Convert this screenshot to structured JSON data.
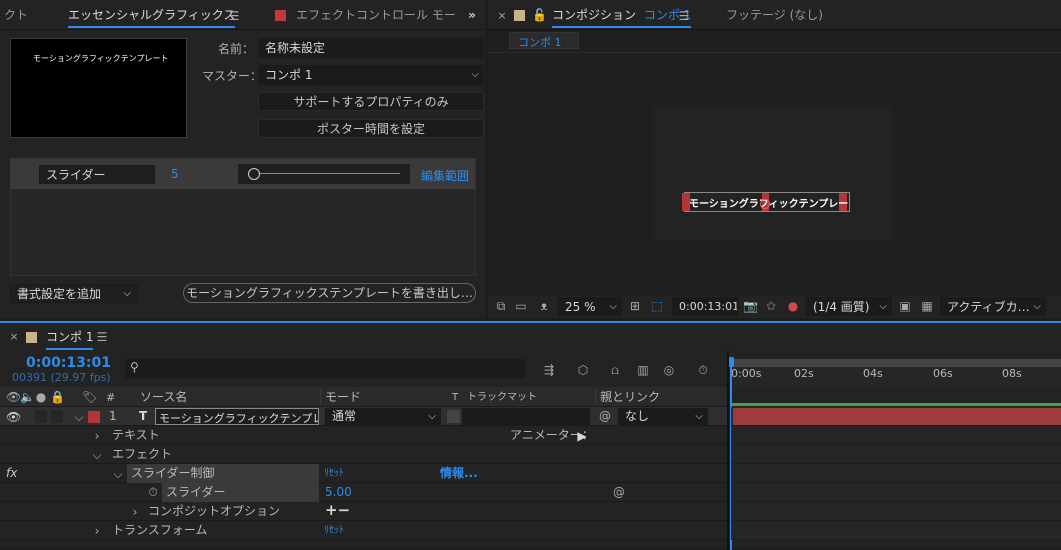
{
  "left_panel": {
    "tabs": [
      "クト",
      "エッセンシャルグラフィックス",
      "エフェクトコントロール モー"
    ],
    "preview_text": "モーショングラフィックテンプレート",
    "name_label": "名前：",
    "name_value": "名称未設定",
    "master_label": "マスター：",
    "master_value": "コンポ 1",
    "btn_supported": "サポートするプロパティのみ",
    "btn_poster": "ポスター時間を設定",
    "slider_name": "スライダー",
    "slider_value": "5",
    "slider_fraction": 0.0,
    "edit_range": "編集範囲",
    "add_format": "書式設定を追加",
    "export_btn": "モーショングラフィックステンプレートを書き出し…"
  },
  "comp_panel": {
    "tab_label": "コンポジション",
    "tab_comp": "コンポ 1",
    "footage_tab": "フッテージ (なし)",
    "breadcrumb": "コンポ 1",
    "canvas_text": "モーショングラフィックテンプレー",
    "zoom": "25 %",
    "timecode": "0:00:13:01",
    "resolution": "(1/4 画質)",
    "camera": "アクティブカ…"
  },
  "timeline": {
    "tab_label": "コンポ 1",
    "timecode": "0:00:13:01",
    "frames": "00391 (29.97 fps)",
    "search_placeholder": "",
    "col_num": "#",
    "col_source": "ソース名",
    "col_mode": "モード",
    "col_t": "T",
    "col_trackmatte": "トラックマット",
    "col_parent": "親とリンク",
    "layer_num": "1",
    "layer_type": "T",
    "layer_name": "モーショングラフィックテンプレート",
    "layer_mode": "通常",
    "layer_parent": "なし",
    "text_group": "テキスト",
    "animator": "アニメーター：",
    "effects_group": "エフェクト",
    "effect_name": "スライダー制御",
    "reset": "ﾘｾｯﾄ",
    "info": "情報...",
    "slider_prop": "スライダー",
    "slider_val": "5.00",
    "composite": "コンポジットオプション",
    "transform": "トランスフォーム",
    "ruler": [
      "0:00s",
      "02s",
      "04s",
      "06s",
      "08s"
    ],
    "fx_label": "fx"
  },
  "colors": {
    "accent": "#2d8ceb",
    "layer_red": "#b33535",
    "layer_bar": "#9e3b3b",
    "work_green": "#3aa84b"
  }
}
